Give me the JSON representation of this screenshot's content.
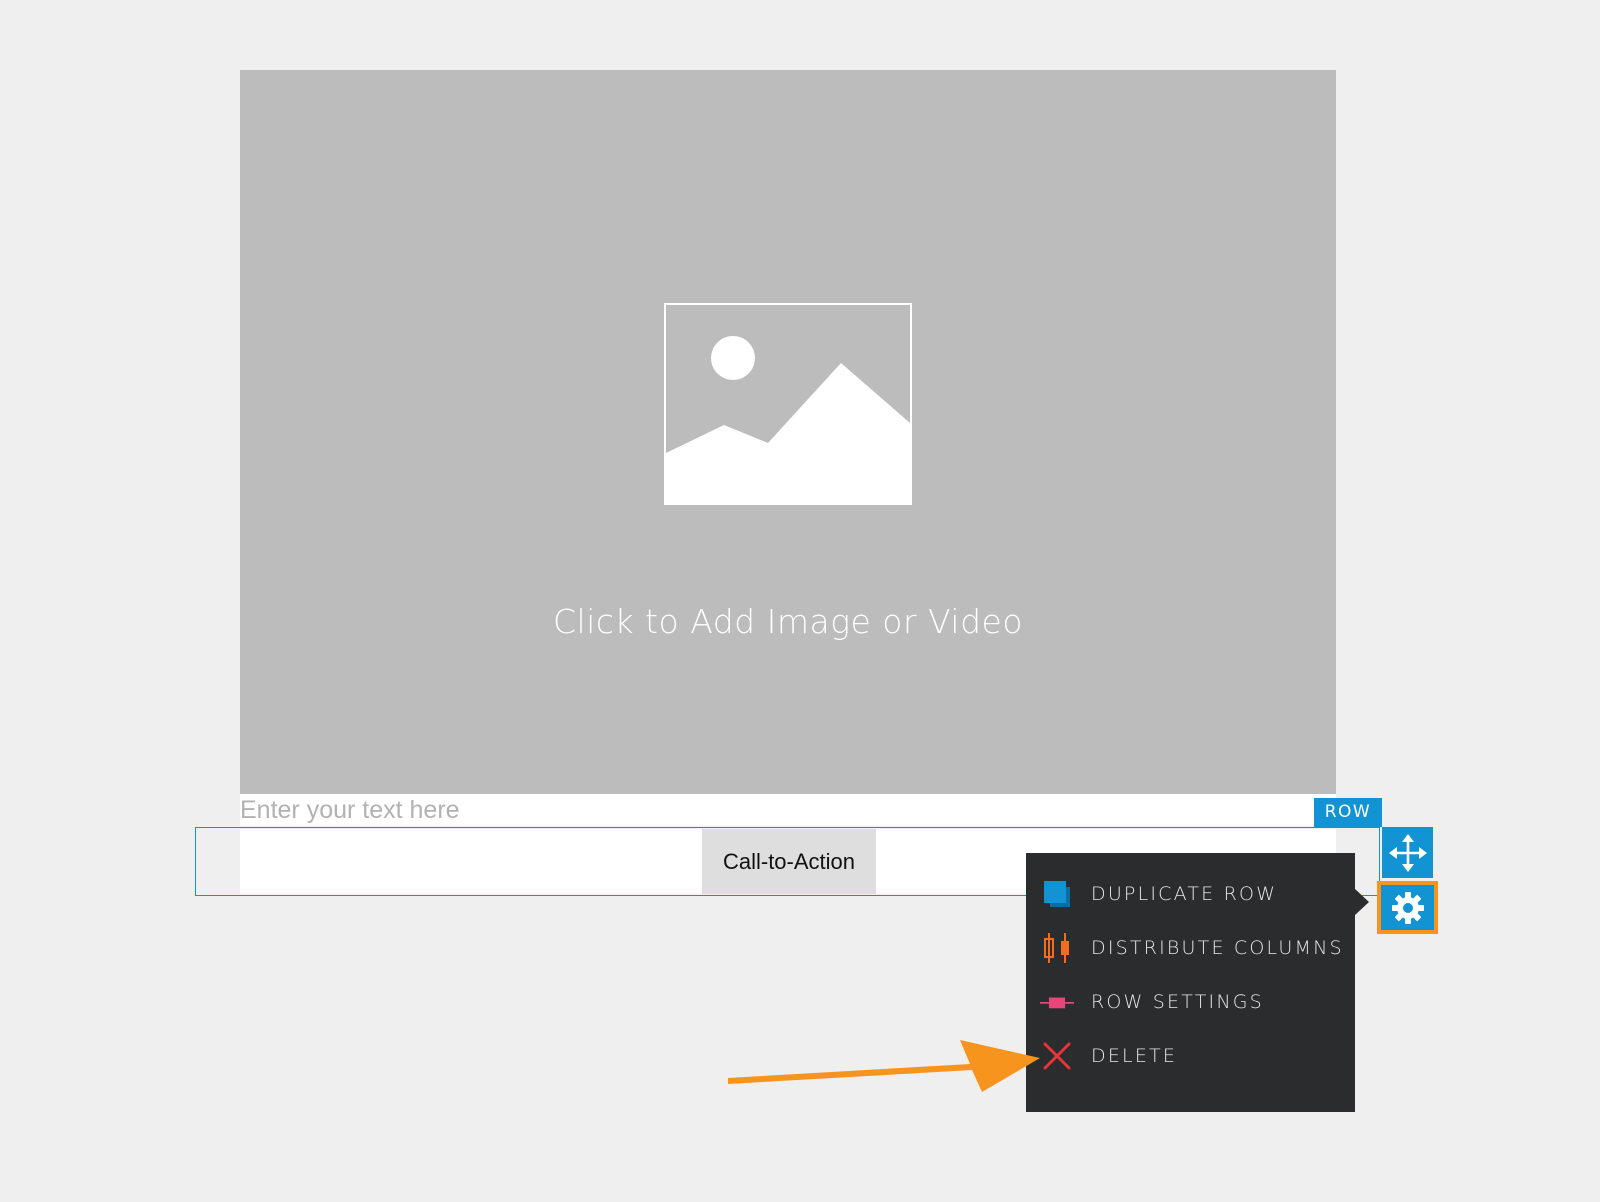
{
  "media": {
    "label": "Click to Add Image or Video",
    "icon": "image-placeholder-icon"
  },
  "text_block": {
    "placeholder": "Enter your text here"
  },
  "row": {
    "tag": "ROW",
    "cta_label": "Call-to-Action",
    "controls": {
      "move_icon": "move-arrows-icon",
      "settings_icon": "gear-icon"
    }
  },
  "menu": {
    "items": [
      {
        "label": "DUPLICATE ROW",
        "icon": "duplicate-icon",
        "icon_color": "#1294d4"
      },
      {
        "label": "DISTRIBUTE COLUMNS",
        "icon": "distribute-columns-icon",
        "icon_color": "#f26c22"
      },
      {
        "label": "ROW SETTINGS",
        "icon": "row-settings-icon",
        "icon_color": "#e8457a"
      },
      {
        "label": "DELETE",
        "icon": "delete-x-icon",
        "icon_color": "#e8343a"
      }
    ]
  },
  "colors": {
    "accent": "#1294d4",
    "highlight": "#f7941d",
    "menu_background": "#2b2c2e",
    "placeholder_background": "#bcbcbc",
    "page_background": "#efefef"
  }
}
